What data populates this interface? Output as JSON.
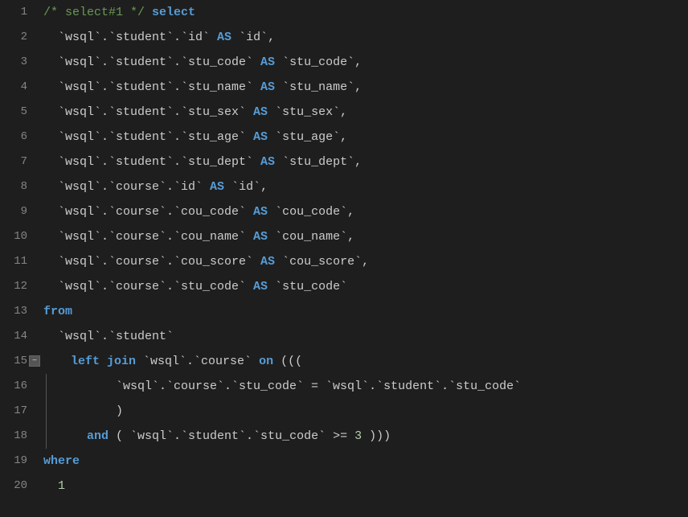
{
  "editor": {
    "background": "#1e1e1e",
    "lines": [
      {
        "num": 1,
        "tokens": [
          {
            "text": "/* select#1 */ ",
            "class": "comment"
          },
          {
            "text": "select",
            "class": "kw-blue"
          }
        ]
      },
      {
        "num": 2,
        "tokens": [
          {
            "text": "  `wsql`.`student`.`id` ",
            "class": "backtick"
          },
          {
            "text": "AS",
            "class": "as-kw"
          },
          {
            "text": " `id`,",
            "class": "backtick"
          }
        ]
      },
      {
        "num": 3,
        "tokens": [
          {
            "text": "  `wsql`.`student`.`stu_code` ",
            "class": "backtick"
          },
          {
            "text": "AS",
            "class": "as-kw"
          },
          {
            "text": " `stu_code`,",
            "class": "backtick"
          }
        ]
      },
      {
        "num": 4,
        "tokens": [
          {
            "text": "  `wsql`.`student`.`stu_name` ",
            "class": "backtick"
          },
          {
            "text": "AS",
            "class": "as-kw"
          },
          {
            "text": " `stu_name`,",
            "class": "backtick"
          }
        ]
      },
      {
        "num": 5,
        "tokens": [
          {
            "text": "  `wsql`.`student`.`stu_sex` ",
            "class": "backtick"
          },
          {
            "text": "AS",
            "class": "as-kw"
          },
          {
            "text": " `stu_sex`,",
            "class": "backtick"
          }
        ]
      },
      {
        "num": 6,
        "tokens": [
          {
            "text": "  `wsql`.`student`.`stu_age` ",
            "class": "backtick"
          },
          {
            "text": "AS",
            "class": "as-kw"
          },
          {
            "text": " `stu_age`,",
            "class": "backtick"
          }
        ]
      },
      {
        "num": 7,
        "tokens": [
          {
            "text": "  `wsql`.`student`.`stu_dept` ",
            "class": "backtick"
          },
          {
            "text": "AS",
            "class": "as-kw"
          },
          {
            "text": " `stu_dept`,",
            "class": "backtick"
          }
        ]
      },
      {
        "num": 8,
        "tokens": [
          {
            "text": "  `wsql`.`course`.`id` ",
            "class": "backtick"
          },
          {
            "text": "AS",
            "class": "as-kw"
          },
          {
            "text": " `id`,",
            "class": "backtick"
          }
        ]
      },
      {
        "num": 9,
        "tokens": [
          {
            "text": "  `wsql`.`course`.`cou_code` ",
            "class": "backtick"
          },
          {
            "text": "AS",
            "class": "as-kw"
          },
          {
            "text": " `cou_code`,",
            "class": "backtick"
          }
        ]
      },
      {
        "num": 10,
        "tokens": [
          {
            "text": "  `wsql`.`course`.`cou_name` ",
            "class": "backtick"
          },
          {
            "text": "AS",
            "class": "as-kw"
          },
          {
            "text": " `cou_name`,",
            "class": "backtick"
          }
        ]
      },
      {
        "num": 11,
        "tokens": [
          {
            "text": "  `wsql`.`course`.`cou_score` ",
            "class": "backtick"
          },
          {
            "text": "AS",
            "class": "as-kw"
          },
          {
            "text": " `cou_score`,",
            "class": "backtick"
          }
        ]
      },
      {
        "num": 12,
        "tokens": [
          {
            "text": "  `wsql`.`course`.`stu_code` ",
            "class": "backtick"
          },
          {
            "text": "AS",
            "class": "as-kw"
          },
          {
            "text": " `stu_code`",
            "class": "backtick"
          }
        ]
      },
      {
        "num": 13,
        "tokens": [
          {
            "text": "from",
            "class": "kw-blue"
          }
        ]
      },
      {
        "num": 14,
        "tokens": [
          {
            "text": "  `wsql`.`student`",
            "class": "backtick"
          }
        ]
      },
      {
        "num": 15,
        "tokens": [
          {
            "text": "  ",
            "class": "backtick"
          },
          {
            "text": "left join",
            "class": "kw-blue"
          },
          {
            "text": " `wsql`.`course` ",
            "class": "backtick"
          },
          {
            "text": "on",
            "class": "kw-blue"
          },
          {
            "text": " (((",
            "class": "backtick"
          }
        ],
        "hasFold": true,
        "foldLabel": "−"
      },
      {
        "num": 16,
        "tokens": [
          {
            "text": "          `wsql`.`course`.`stu_code` = `wsql`.`student`.`stu_code`",
            "class": "backtick"
          }
        ],
        "isFoldChild": true
      },
      {
        "num": 17,
        "tokens": [
          {
            "text": "          )",
            "class": "backtick"
          }
        ],
        "isFoldChild": true
      },
      {
        "num": 18,
        "tokens": [
          {
            "text": "      ",
            "class": "backtick"
          },
          {
            "text": "and",
            "class": "kw-blue"
          },
          {
            "text": " ( `wsql`.`student`.`stu_code` >= ",
            "class": "backtick"
          },
          {
            "text": "3",
            "class": "number"
          },
          {
            "text": " )))",
            "class": "backtick"
          }
        ],
        "isFoldChild": true
      },
      {
        "num": 19,
        "tokens": [
          {
            "text": "where",
            "class": "kw-blue"
          }
        ]
      },
      {
        "num": 20,
        "tokens": [
          {
            "text": "  ",
            "class": "backtick"
          },
          {
            "text": "1",
            "class": "number"
          }
        ]
      }
    ]
  }
}
